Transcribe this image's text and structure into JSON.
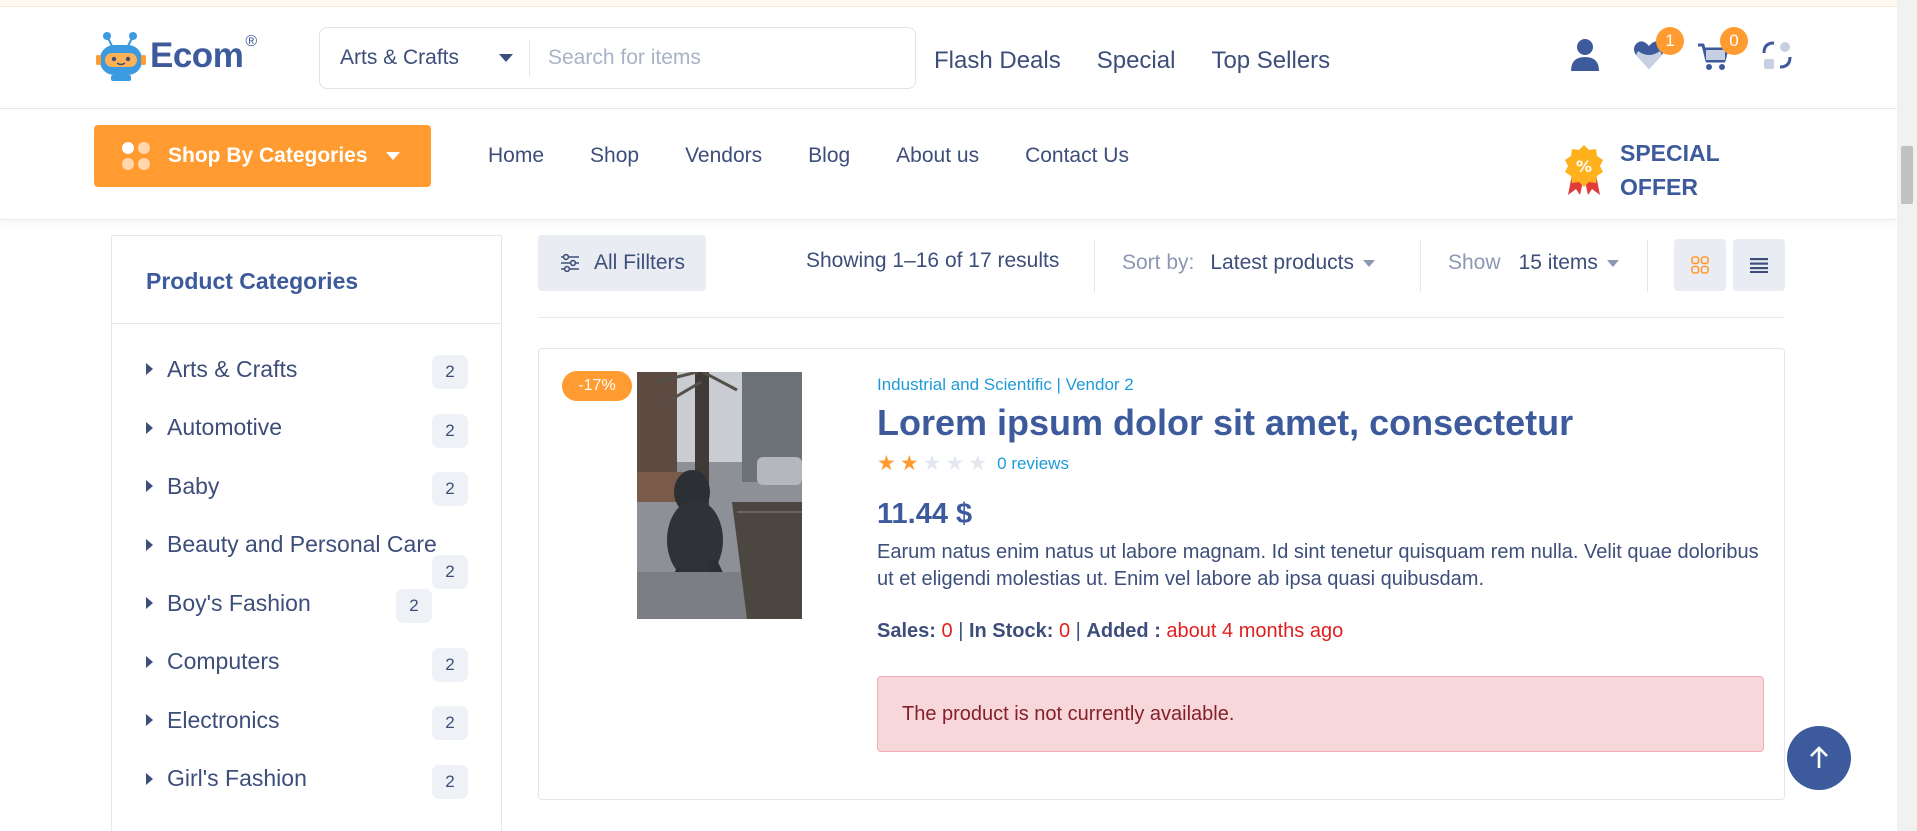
{
  "brand": {
    "name": "Ecom",
    "reg": "®"
  },
  "search": {
    "category": "Arts & Crafts",
    "placeholder": "Search for items"
  },
  "top_links": [
    "Flash Deals",
    "Special",
    "Top Sellers"
  ],
  "header_icons": {
    "wishlist_count": "1",
    "cart_count": "0"
  },
  "shop_by_categories": "Shop By Categories",
  "main_nav": [
    "Home",
    "Shop",
    "Vendors",
    "Blog",
    "About us",
    "Contact Us"
  ],
  "special_offer": {
    "line1": "SPECIAL",
    "line2": "OFFER"
  },
  "sidebar": {
    "title": "Product Categories",
    "items": [
      {
        "label": "Arts & Crafts",
        "count": "2"
      },
      {
        "label": "Automotive",
        "count": "2"
      },
      {
        "label": "Baby",
        "count": "2"
      },
      {
        "label": "Beauty and Personal Care",
        "count": "2"
      },
      {
        "label": "Boy's Fashion",
        "count": "2"
      },
      {
        "label": "Computers",
        "count": "2"
      },
      {
        "label": "Electronics",
        "count": "2"
      },
      {
        "label": "Girl's Fashion",
        "count": "2"
      }
    ]
  },
  "toolbar": {
    "filters_label": "All Fillters",
    "results": "Showing 1–16 of 17 results",
    "sort_label": "Sort by:",
    "sort_value": "Latest products",
    "show_label": "Show",
    "show_value": "15 items"
  },
  "product": {
    "discount": "-17%",
    "meta": "Industrial and Scientific | Vendor 2",
    "title": "Lorem ipsum dolor sit amet, consectetur",
    "rating": 2,
    "rating_max": 5,
    "reviews": "0 reviews",
    "price": "11.44 $",
    "description": "Earum natus enim natus ut labore magnam. Id sint tenetur quisquam rem nulla. Velit quae doloribus ut et eligendi molestias ut. Enim vel labore ab ipsa quasi quibusdam.",
    "sales_label": "Sales:",
    "sales_value": "0",
    "stock_label": "In Stock:",
    "stock_value": "0",
    "added_label": "Added :",
    "added_value": "about 4 months ago",
    "alert": "The product is not currently available."
  },
  "colors": {
    "accent": "#ff9b31",
    "brand": "#3d5a9c",
    "link": "#1e9bd7",
    "danger": "#e02020",
    "alert_bg": "#f8d7da"
  }
}
